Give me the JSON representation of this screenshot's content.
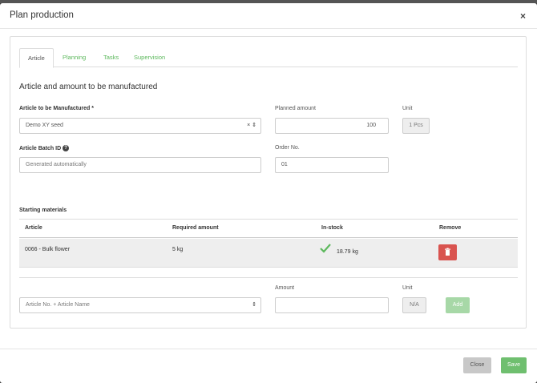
{
  "modal": {
    "title": "Plan production",
    "close_symbol": "×"
  },
  "tabs": [
    {
      "label": "Article",
      "active": true
    },
    {
      "label": "Planning",
      "active": false
    },
    {
      "label": "Tasks",
      "active": false
    },
    {
      "label": "Supervision",
      "active": false
    }
  ],
  "section": {
    "title": "Article and amount to be manufactured",
    "article_label": "Article to be Manufactured",
    "required_mark": "*",
    "article_value": "Demo XY seed",
    "planned_label": "Planned amount",
    "planned_value": "100",
    "unit_label": "Unit",
    "unit_value": "1 Pcs",
    "batch_label": "Article Batch ID",
    "batch_placeholder": "Generated automatically",
    "order_label": "Order No.",
    "order_value": "01"
  },
  "materials": {
    "title": "Starting materials",
    "columns": [
      "Article",
      "Required amount",
      "In-stock",
      "Remove"
    ],
    "rows": [
      {
        "article": "0066 - Bulk flower",
        "required": "5 kg",
        "stock": "18.79 kg"
      }
    ]
  },
  "add_row": {
    "article_placeholder": "Article No. + Article Name",
    "amount_label": "Amount",
    "unit_label": "Unit",
    "unit_value": "N/A",
    "add_label": "Add"
  },
  "footer": {
    "close_label": "Close",
    "save_label": "Save"
  },
  "colors": {
    "accent": "#5cb85c",
    "danger": "#d9534f",
    "disabled": "#a7d8a7"
  }
}
